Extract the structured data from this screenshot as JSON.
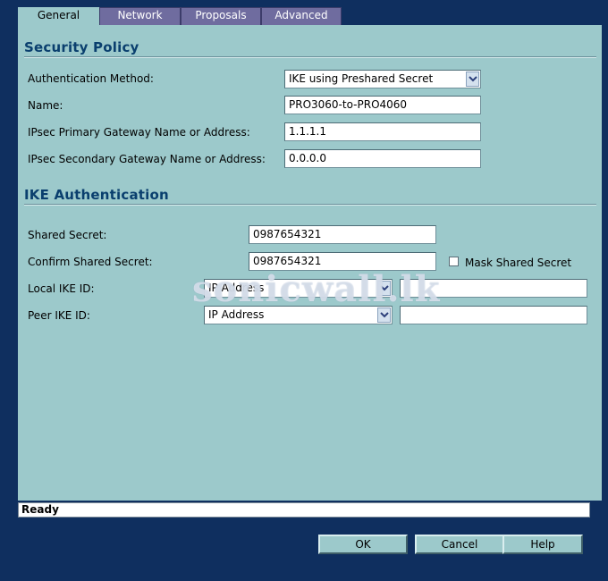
{
  "tabs": [
    {
      "label": "General",
      "active": true
    },
    {
      "label": "Network",
      "active": false
    },
    {
      "label": "Proposals",
      "active": false
    },
    {
      "label": "Advanced",
      "active": false
    }
  ],
  "security_policy": {
    "title": "Security Policy",
    "auth_method_label": "Authentication Method:",
    "auth_method_value": "IKE using Preshared Secret",
    "name_label": "Name:",
    "name_value": "PRO3060-to-PRO4060",
    "primary_gateway_label": "IPsec Primary Gateway Name or Address:",
    "primary_gateway_value": "1.1.1.1",
    "secondary_gateway_label": "IPsec Secondary Gateway Name or Address:",
    "secondary_gateway_value": "0.0.0.0"
  },
  "ike_authentication": {
    "title": "IKE Authentication",
    "shared_secret_label": "Shared Secret:",
    "shared_secret_value": "0987654321",
    "confirm_secret_label": "Confirm Shared Secret:",
    "confirm_secret_value": "0987654321",
    "mask_label": "Mask Shared Secret",
    "mask_checked": false,
    "local_ike_label": "Local IKE ID:",
    "local_ike_type": "IP Address",
    "local_ike_value": "",
    "peer_ike_label": "Peer IKE ID:",
    "peer_ike_type": "IP Address",
    "peer_ike_value": ""
  },
  "watermark": "sonicwall.lk",
  "status": "Ready",
  "buttons": {
    "ok": "OK",
    "cancel": "Cancel",
    "help": "Help"
  },
  "colors": {
    "background": "#0f2f5f",
    "panel": "#9cc9cb",
    "tab_inactive": "#6f6c9f",
    "heading": "#0a3f6e"
  }
}
